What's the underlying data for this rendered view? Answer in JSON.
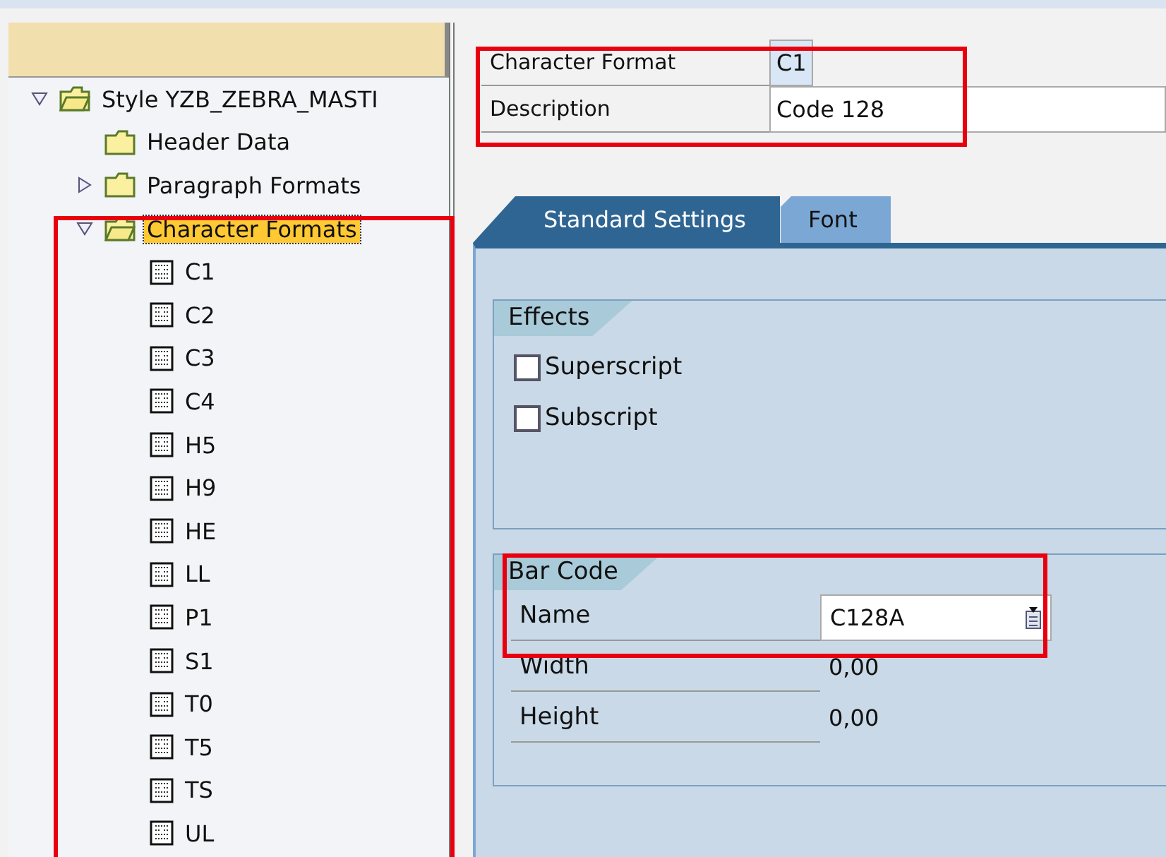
{
  "tree": [
    {
      "label": "Style YZB_ZEBRA_MASTI",
      "kind": "folder",
      "expanded": true,
      "selected": false,
      "children": [
        {
          "label": "Header Data",
          "kind": "folder",
          "selected": false
        },
        {
          "label": "Paragraph Formats",
          "kind": "folder",
          "expanded": false,
          "selected": false
        },
        {
          "label": "Character Formats",
          "kind": "folder",
          "expanded": true,
          "selected": true,
          "children": [
            {
              "label": "C1",
              "kind": "format",
              "selected": false
            },
            {
              "label": "C2",
              "kind": "format",
              "selected": false
            },
            {
              "label": "C3",
              "kind": "format",
              "selected": false
            },
            {
              "label": "C4",
              "kind": "format",
              "selected": false
            },
            {
              "label": "H5",
              "kind": "format",
              "selected": false
            },
            {
              "label": "H9",
              "kind": "format",
              "selected": false
            },
            {
              "label": "HE",
              "kind": "format",
              "selected": false
            },
            {
              "label": "LL",
              "kind": "format",
              "selected": false
            },
            {
              "label": "P1",
              "kind": "format",
              "selected": false
            },
            {
              "label": "S1",
              "kind": "format",
              "selected": false
            },
            {
              "label": "T0",
              "kind": "format",
              "selected": false
            },
            {
              "label": "T5",
              "kind": "format",
              "selected": false
            },
            {
              "label": "TS",
              "kind": "format",
              "selected": false
            },
            {
              "label": "UL",
              "kind": "format",
              "selected": false
            }
          ]
        }
      ]
    }
  ],
  "header": {
    "character_format": {
      "label": "Character Format",
      "value": "C1"
    },
    "description": {
      "label": "Description",
      "value": "Code 128"
    }
  },
  "tabs": [
    {
      "label": "Standard Settings",
      "selected": true
    },
    {
      "label": "Font",
      "selected": false
    }
  ],
  "effects": {
    "title": "Effects",
    "options": [
      {
        "label": "Superscript",
        "checked": false
      },
      {
        "label": "Subscript",
        "checked": false
      }
    ]
  },
  "bar_code": {
    "title": "Bar Code",
    "name": {
      "label": "Name",
      "value": "C128A"
    },
    "rows": [
      {
        "label": "Width",
        "value": "0,00"
      },
      {
        "label": "Height",
        "value": "0,00"
      }
    ]
  }
}
